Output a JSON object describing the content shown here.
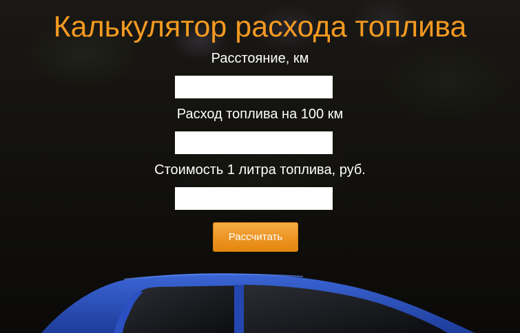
{
  "page": {
    "title": "Калькулятор расхода топлива",
    "accent_color": "#f39a21"
  },
  "form": {
    "distance_label": "Расстояние, км",
    "distance_value": "",
    "consumption_label": "Расход топлива на 100 км",
    "consumption_value": "",
    "price_label": "Стоимость 1 литра топлива, руб.",
    "price_value": "",
    "calculate_button": "Рассчитать"
  },
  "background": {
    "image": "dark-forest-with-blue-car",
    "car_color": "#2a4fb8"
  }
}
